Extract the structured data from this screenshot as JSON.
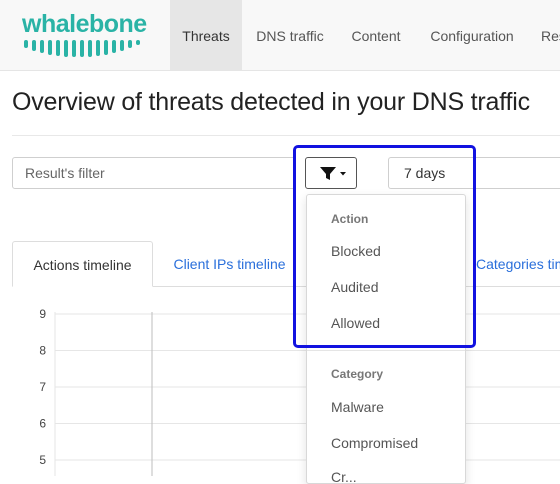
{
  "app": {
    "brand": "whalebone",
    "brand_color": "#2ab3a6",
    "accent": "#2a6fdb"
  },
  "nav": {
    "tabs": [
      {
        "label": "Threats",
        "active": true
      },
      {
        "label": "DNS traffic"
      },
      {
        "label": "Content"
      },
      {
        "label": "Configuration"
      },
      {
        "label": "Res"
      }
    ]
  },
  "page": {
    "title": "Overview of threats detected in your DNS traffic"
  },
  "filters": {
    "result_placeholder": "Result's filter",
    "filter_icon": "filter-icon",
    "range": "7 days"
  },
  "dropdown": {
    "sections": [
      {
        "header": "Action",
        "items": [
          "Blocked",
          "Audited",
          "Allowed"
        ]
      },
      {
        "header": "Category",
        "items": [
          "Malware",
          "Compromised",
          "Cr..."
        ]
      }
    ]
  },
  "chart_tabs": [
    {
      "label": "Actions timeline",
      "active": true
    },
    {
      "label": "Client IPs timeline"
    },
    {
      "label": "Categories tim"
    }
  ],
  "chart_data": {
    "type": "bar",
    "y_ticks": [
      "9",
      "8",
      "7",
      "6",
      "5"
    ],
    "ylim": [
      5,
      9
    ],
    "grid": true
  }
}
